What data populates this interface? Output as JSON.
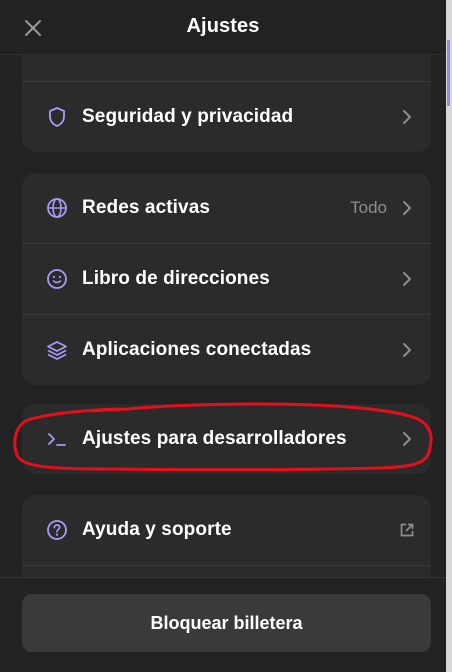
{
  "header": {
    "title": "Ajustes",
    "close_icon": "close-icon"
  },
  "sections": {
    "security": {
      "label": "Seguridad y privacidad",
      "icon": "shield-icon"
    },
    "networks": {
      "label": "Redes activas",
      "value": "Todo",
      "icon": "globe-icon"
    },
    "address_book": {
      "label": "Libro de direcciones",
      "icon": "smiley-icon"
    },
    "connected_apps": {
      "label": "Aplicaciones conectadas",
      "icon": "layers-icon"
    },
    "developer": {
      "label": "Ajustes para desarrolladores",
      "icon": "terminal-icon"
    },
    "help": {
      "label": "Ayuda y soporte",
      "icon": "question-circle-icon",
      "trailing_icon": "external-link-icon"
    }
  },
  "footer": {
    "lock_label": "Bloquear billetera"
  },
  "colors": {
    "background": "#222222",
    "card": "#2b2b2b",
    "icon_accent": "#a99bf5",
    "muted_text": "#8d8d8d",
    "button": "#3a3a3a",
    "annotation": "#e3101b"
  }
}
